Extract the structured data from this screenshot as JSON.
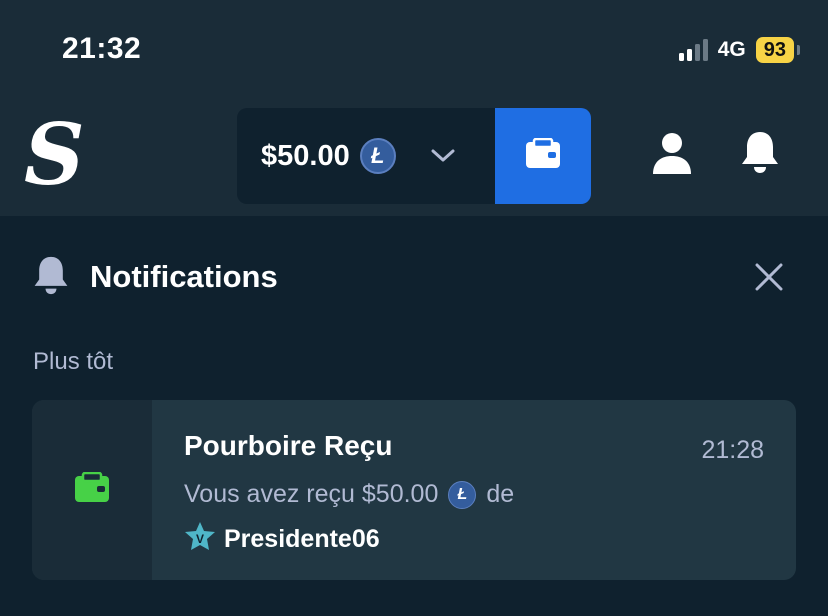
{
  "status_bar": {
    "time": "21:32",
    "network": "4G",
    "battery": "93"
  },
  "header": {
    "logo_letter": "S",
    "balance": "$50.00",
    "currency_icon": "litecoin-icon",
    "currency_symbol": "Ł",
    "wallet_icon": "wallet-icon",
    "profile_icon": "user-icon",
    "notifications_icon": "bell-icon"
  },
  "notifications": {
    "title": "Notifications",
    "section_label": "Plus tôt",
    "items": [
      {
        "title": "Pourboire Reçu",
        "time": "21:28",
        "message_prefix": "Vous avez reçu $50.00",
        "message_suffix": "de",
        "sender": "Presidente06",
        "sender_badge_letter": "V",
        "icon": "wallet-icon"
      }
    ]
  },
  "colors": {
    "background": "#0f212e",
    "header_bg": "#1a2c38",
    "card_bg": "#213743",
    "accent_blue": "#1f6ee3",
    "notification_green": "#47d147",
    "vip_teal": "#4fb6c8",
    "battery_yellow": "#f7d346",
    "muted_text": "#b1bad3"
  }
}
